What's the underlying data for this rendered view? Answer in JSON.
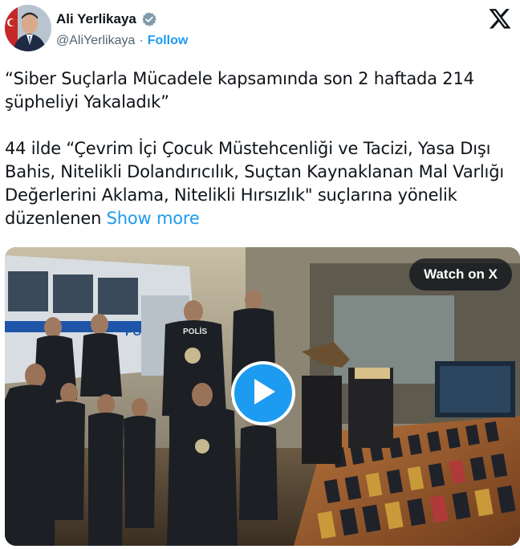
{
  "author": {
    "display_name": "Ali Yerlikaya",
    "handle": "@AliYerlikaya",
    "separator": "·",
    "follow_label": "Follow",
    "verified": true
  },
  "icons": {
    "verified": "verified-badge-icon",
    "platform": "x-logo-icon",
    "play": "play-icon"
  },
  "tweet": {
    "paragraph1": "“Siber Suçlarla Mücadele kapsamında son 2 haftada 214 şüpheliyi Yakaladık”",
    "paragraph2": "44 ilde “Çevrim İçi Çocuk Müstehcenliği ve Tacizi, Yasa Dışı Bahis, Nitelikli Dolandırıcılık, Suçtan Kaynaklanan Mal Varlığı Değerlerini Aklama, Nitelikli Hırsızlık\" suçlarına yönelik düzenlenen",
    "show_more_label": "Show more"
  },
  "media": {
    "watch_label": "Watch on X",
    "bus_label": "POLİS",
    "vest_label": "POLİS"
  },
  "colors": {
    "accent": "#1d9bf0",
    "text": "#0f1419",
    "secondary": "#536471"
  }
}
